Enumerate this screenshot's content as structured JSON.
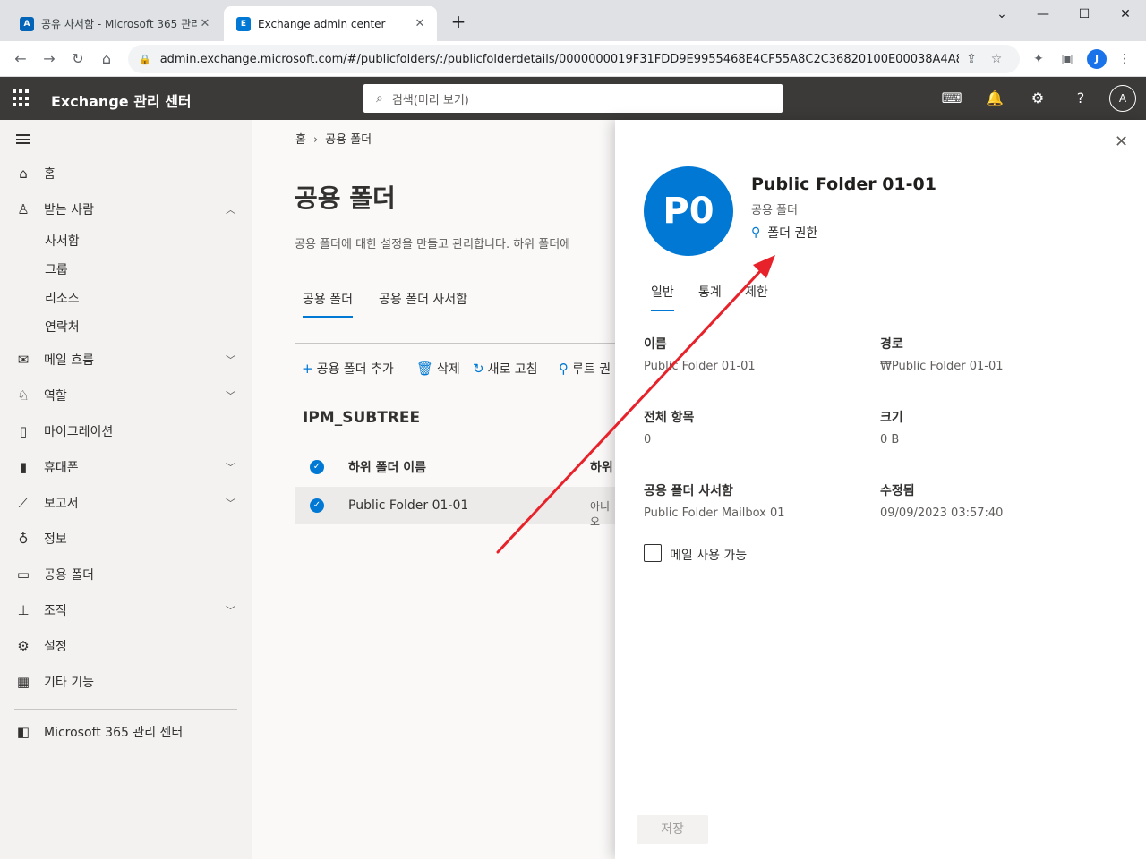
{
  "browser": {
    "tabs": [
      {
        "title": "공유 사서함 - Microsoft 365 관리",
        "favicon": "A",
        "favicon_color": "#0364b8"
      },
      {
        "title": "Exchange admin center",
        "favicon": "E",
        "favicon_color": "#0078d4"
      }
    ],
    "url": "admin.exchange.microsoft.com/#/publicfolders/:/publicfolderdetails/0000000019F31FDD9E9955468E4CF55A8C2C36820100E00038A4A88E1...",
    "profile_initial": "J"
  },
  "header": {
    "app_title": "Exchange 관리 센터",
    "search_placeholder": "검색(미리 보기)",
    "user_initial": "A"
  },
  "nav": {
    "items": [
      {
        "label": "홈",
        "icon": "home-icon"
      },
      {
        "label": "받는 사람",
        "icon": "person-icon",
        "expanded": true
      },
      {
        "label": "메일 흐름",
        "icon": "mail-icon"
      },
      {
        "label": "역할",
        "icon": "roles-icon"
      },
      {
        "label": "마이그레이션",
        "icon": "migration-icon"
      },
      {
        "label": "휴대폰",
        "icon": "mobile-icon"
      },
      {
        "label": "보고서",
        "icon": "reports-icon"
      },
      {
        "label": "정보",
        "icon": "insights-icon"
      },
      {
        "label": "공용 폴더",
        "icon": "public-folder-icon"
      },
      {
        "label": "조직",
        "icon": "organization-icon"
      },
      {
        "label": "설정",
        "icon": "settings-icon"
      },
      {
        "label": "기타 기능",
        "icon": "table-icon"
      }
    ],
    "recipients_sub": [
      "사서함",
      "그룹",
      "리소스",
      "연락처"
    ],
    "m365_link": "Microsoft 365 관리 센터"
  },
  "main": {
    "breadcrumb": [
      "홈",
      "공용 폴더"
    ],
    "title": "공용 폴더",
    "description": "공용 폴더에 대한 설정을 만들고 관리합니다. 하위 폴더에",
    "tabs": [
      "공용 폴더",
      "공용 폴더 사서함"
    ],
    "commands": [
      "공용 폴더 추가",
      "삭제",
      "새로 고침",
      "루트 권"
    ],
    "subtree": "IPM_SUBTREE",
    "list_header": [
      "하위 폴더 이름",
      "하위"
    ],
    "rows": [
      {
        "name": "Public Folder 01-01",
        "sub": "아니오"
      }
    ]
  },
  "panel": {
    "avatar": "P0",
    "title": "Public Folder 01-01",
    "subtitle": "공용 폴더",
    "permission_link": "폴더 권한",
    "tabs": [
      "일반",
      "통계",
      "제한"
    ],
    "fields": {
      "name_label": "이름",
      "name_value": "Public Folder 01-01",
      "path_label": "경로",
      "path_value": "₩Public Folder 01-01",
      "items_label": "전체 항목",
      "items_value": "0",
      "size_label": "크기",
      "size_value": "0 B",
      "mailbox_label": "공용 폴더 사서함",
      "mailbox_value": "Public Folder Mailbox 01",
      "modified_label": "수정됨",
      "modified_value": "09/09/2023 03:57:40"
    },
    "mail_enabled_label": "메일 사용 가능",
    "save_label": "저장"
  },
  "colors": {
    "accent": "#0078d4",
    "header_bg": "#3b3a39",
    "annotation": "#e8222a"
  }
}
